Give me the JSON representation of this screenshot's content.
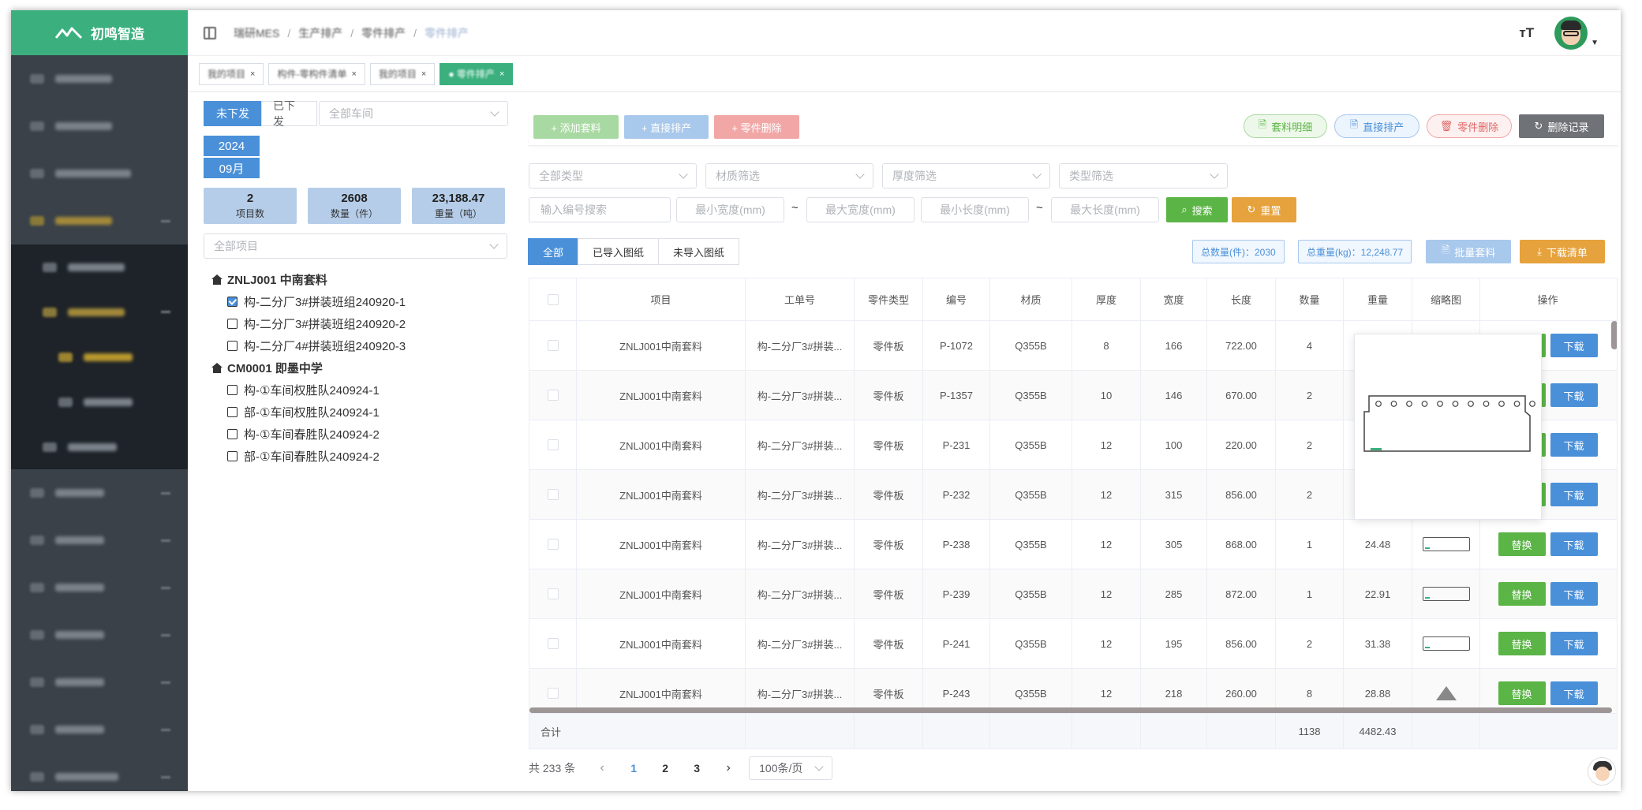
{
  "app": {
    "logo_text": "初鸣智造"
  },
  "breadcrumb": [
    "瑞研MES",
    "生产排产",
    "零件排产",
    "零件排产"
  ],
  "header": {
    "font_icon": "тT"
  },
  "tags": [
    {
      "label": "我的项目",
      "active": false
    },
    {
      "label": "构件-零构件清单",
      "active": false
    },
    {
      "label": "我的项目",
      "active": false
    },
    {
      "label": "● 零件排产",
      "active": true
    }
  ],
  "left": {
    "tab_undispatched": "未下发",
    "tab_dispatched": "已下发",
    "workshop_placeholder": "全部车间",
    "year": "2024",
    "month": "09月",
    "stats": [
      {
        "value": "2",
        "label": "项目数"
      },
      {
        "value": "2608",
        "label": "数量（件）"
      },
      {
        "value": "23,188.47",
        "label": "重量（吨）"
      }
    ],
    "project_placeholder": "全部项目",
    "tree": [
      {
        "root": "ZNLJ001 中南套料",
        "children": [
          {
            "label": "构-二分厂3#拼装班组240920-1",
            "checked": true
          },
          {
            "label": "构-二分厂3#拼装班组240920-2",
            "checked": false
          },
          {
            "label": "构-二分厂4#拼装班组240920-3",
            "checked": false
          }
        ]
      },
      {
        "root": "CM0001 即墨中学",
        "children": [
          {
            "label": "构-①车间权胜队240924-1",
            "checked": false
          },
          {
            "label": "部-①车间权胜队240924-1",
            "checked": false
          },
          {
            "label": "构-①车间春胜队240924-2",
            "checked": false
          },
          {
            "label": "部-①车间春胜队240924-2",
            "checked": false
          }
        ]
      }
    ]
  },
  "toolbar": {
    "add_nesting": "+ 添加套料",
    "direct_schedule": "+ 直接排产",
    "delete_part": "+ 零件删除",
    "nesting_detail": "套料明细",
    "direct_schedule_pill": "直接排产",
    "delete_part_pill": "零件删除",
    "delete_record": "删除记录"
  },
  "filters": {
    "all_types": "全部类型",
    "material_filter": "材质筛选",
    "thickness_filter": "厚度筛选",
    "type_filter": "类型筛选",
    "code_search": "输入编号搜索",
    "min_width": "最小宽度(mm)",
    "max_width": "最大宽度(mm)",
    "min_length": "最小长度(mm)",
    "max_length": "最大长度(mm)",
    "tilde": "~",
    "search": "搜索",
    "reset": "重置"
  },
  "segments": [
    "全部",
    "已导入图纸",
    "未导入图纸"
  ],
  "summary_chips": {
    "total_qty": "总数量(件)：2030",
    "total_weight": "总重量(kg)：12,248.77",
    "batch_nest": "批量套料",
    "download_list": "下载清单"
  },
  "table": {
    "headers": [
      "",
      "项目",
      "工单号",
      "零件类型",
      "编号",
      "材质",
      "厚度",
      "宽度",
      "长度",
      "数量",
      "重量",
      "缩略图",
      "操作"
    ],
    "rows": [
      {
        "project": "ZNLJ001中南套料",
        "order": "构-二分厂3#拼装...",
        "type": "零件板",
        "code": "P-1072",
        "material": "Q355B",
        "thickness": "8",
        "width": "166",
        "length": "722.00",
        "qty": "4",
        "weight": "",
        "thumb": "rect"
      },
      {
        "project": "ZNLJ001中南套料",
        "order": "构-二分厂3#拼装...",
        "type": "零件板",
        "code": "P-1357",
        "material": "Q355B",
        "thickness": "10",
        "width": "146",
        "length": "670.00",
        "qty": "2",
        "weight": "",
        "thumb": "rect"
      },
      {
        "project": "ZNLJ001中南套料",
        "order": "构-二分厂3#拼装...",
        "type": "零件板",
        "code": "P-231",
        "material": "Q355B",
        "thickness": "12",
        "width": "100",
        "length": "220.00",
        "qty": "2",
        "weight": "",
        "thumb": "rect"
      },
      {
        "project": "ZNLJ001中南套料",
        "order": "构-二分厂3#拼装...",
        "type": "零件板",
        "code": "P-232",
        "material": "Q355B",
        "thickness": "12",
        "width": "315",
        "length": "856.00",
        "qty": "2",
        "weight": "",
        "thumb": "rect"
      },
      {
        "project": "ZNLJ001中南套料",
        "order": "构-二分厂3#拼装...",
        "type": "零件板",
        "code": "P-238",
        "material": "Q355B",
        "thickness": "12",
        "width": "305",
        "length": "868.00",
        "qty": "1",
        "weight": "24.48",
        "thumb": "rect"
      },
      {
        "project": "ZNLJ001中南套料",
        "order": "构-二分厂3#拼装...",
        "type": "零件板",
        "code": "P-239",
        "material": "Q355B",
        "thickness": "12",
        "width": "285",
        "length": "872.00",
        "qty": "1",
        "weight": "22.91",
        "thumb": "rect"
      },
      {
        "project": "ZNLJ001中南套料",
        "order": "构-二分厂3#拼装...",
        "type": "零件板",
        "code": "P-241",
        "material": "Q355B",
        "thickness": "12",
        "width": "195",
        "length": "856.00",
        "qty": "2",
        "weight": "31.38",
        "thumb": "rect"
      },
      {
        "project": "ZNLJ001中南套料",
        "order": "构-二分厂3#拼装...",
        "type": "零件板",
        "code": "P-243",
        "material": "Q355B",
        "thickness": "12",
        "width": "218",
        "length": "260.00",
        "qty": "8",
        "weight": "28.88",
        "thumb": "tri"
      }
    ],
    "replace_label": "替换",
    "download_label": "下载",
    "sum_label": "合计",
    "sum_qty": "1138",
    "sum_weight": "4482.43"
  },
  "pager": {
    "total": "共 233 条",
    "pages": [
      "1",
      "2",
      "3"
    ],
    "current": "1",
    "page_size": "100条/页"
  },
  "colors": {
    "brand_green": "#3bb07e",
    "primary_blue": "#4a90d9",
    "success_green": "#5bb446",
    "warning_orange": "#e6a23c",
    "gray_button": "#6f7378"
  }
}
